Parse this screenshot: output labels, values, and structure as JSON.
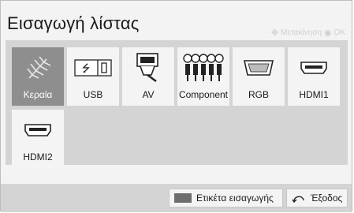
{
  "title": "Εισαγωγή λίστας",
  "hint": {
    "move": "Μετακίνηση",
    "ok": "OK",
    "move_icon": "dpad-icon",
    "ok_icon": "ok-circle-icon"
  },
  "inputs": [
    {
      "label": "Κεραία",
      "icon": "antenna-icon",
      "selected": true
    },
    {
      "label": "USB",
      "icon": "usb-icon"
    },
    {
      "label": "AV",
      "icon": "av-scart-icon"
    },
    {
      "label": "Component",
      "icon": "component-icon"
    },
    {
      "label": "RGB",
      "icon": "rgb-vga-icon"
    },
    {
      "label": "HDMI1",
      "icon": "hdmi-icon"
    },
    {
      "label": "HDMI2",
      "icon": "hdmi-icon"
    }
  ],
  "footer": {
    "edit_label": "Ετικέτα εισαγωγής",
    "edit_color": "#6e6e6e",
    "exit_label": "Έξοδος",
    "exit_icon": "back-arrow-icon"
  }
}
